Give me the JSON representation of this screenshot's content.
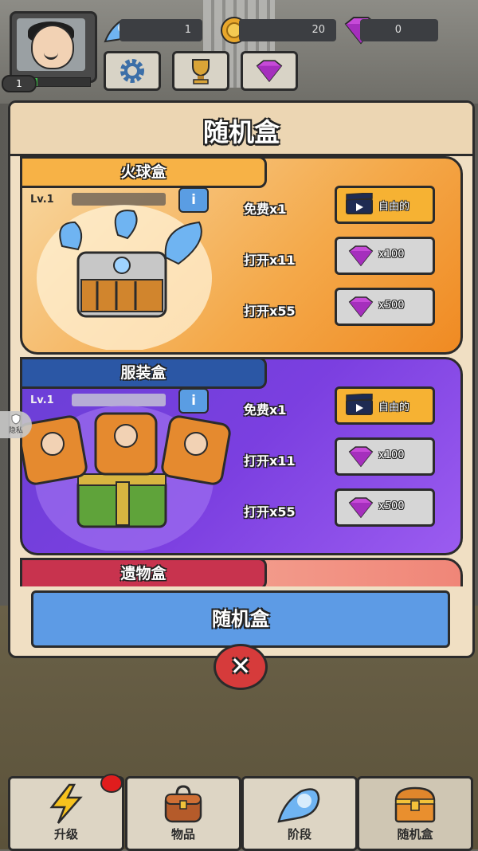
{
  "hud": {
    "player_level": "1",
    "xp_progress": 0.08,
    "resources": [
      {
        "icon": "fireball-icon",
        "value": "1"
      },
      {
        "icon": "gold-coin-icon",
        "value": "20"
      },
      {
        "icon": "gem-icon",
        "value": "0"
      }
    ],
    "buttons": [
      "settings-gear-icon",
      "trophy-icon",
      "gem-icon"
    ]
  },
  "panel": {
    "title": "随机盒",
    "boxes": [
      {
        "id": "fire",
        "name": "火球盒",
        "level": "Lv.1",
        "info": "i",
        "options": [
          {
            "label": "免费x1",
            "button": "自由的",
            "icon": "video-clapper-icon"
          },
          {
            "label": "打开x11",
            "button": "x100",
            "icon": "gem-icon"
          },
          {
            "label": "打开x55",
            "button": "x500",
            "icon": "gem-icon"
          }
        ]
      },
      {
        "id": "costume",
        "name": "服装盒",
        "level": "Lv.1",
        "info": "i",
        "options": [
          {
            "label": "免费x1",
            "button": "自由的",
            "icon": "video-clapper-icon"
          },
          {
            "label": "打开x11",
            "button": "x100",
            "icon": "gem-icon"
          },
          {
            "label": "打开x55",
            "button": "x500",
            "icon": "gem-icon"
          }
        ]
      },
      {
        "id": "relic",
        "name": "遗物盒"
      }
    ],
    "bottom_button": "随机盒",
    "close": "✕"
  },
  "privacy_badge": "隐私",
  "nav": [
    {
      "label": "升级",
      "icon": "lightning-icon",
      "notification": true
    },
    {
      "label": "物品",
      "icon": "backpack-icon"
    },
    {
      "label": "阶段",
      "icon": "fireball-icon"
    },
    {
      "label": "随机盒",
      "icon": "treasure-chest-icon",
      "active": true
    }
  ],
  "colors": {
    "fire_card": "#f4a94a",
    "costume_card": "#7b3fe0",
    "relic_card": "#f08678",
    "video_button": "#f6b233",
    "gem_button": "#d6d6d6",
    "bottom_button": "#5d9be5",
    "close_button": "#d63b3b"
  }
}
